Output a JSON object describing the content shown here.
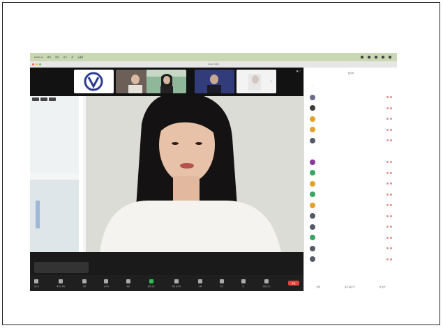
{
  "window": {
    "title": "Zoom 회의"
  },
  "menubar": {
    "items": [
      "zoom.us",
      "회의",
      "편집",
      "보기",
      "창",
      "도움말"
    ],
    "status_icons": [
      "wifi-icon",
      "battery-icon",
      "search-icon",
      "control-center-icon",
      "clock-icon"
    ]
  },
  "participants_strip": [
    {
      "name": "",
      "kind": "logo"
    },
    {
      "name": "",
      "kind": "person"
    },
    {
      "name": "",
      "kind": "person"
    },
    {
      "name": "",
      "kind": "person"
    },
    {
      "name": "",
      "kind": "person"
    }
  ],
  "speaker": {
    "name": ""
  },
  "caption": {
    "text": ""
  },
  "controls": [
    {
      "label": "음소거",
      "icon": "mic-icon"
    },
    {
      "label": "비디오 중지",
      "icon": "camera-icon"
    },
    {
      "label": "보안",
      "icon": "shield-icon"
    },
    {
      "label": "참가자",
      "icon": "people-icon"
    },
    {
      "label": "채팅",
      "icon": "chat-icon"
    },
    {
      "label": "화면 공유",
      "icon": "share-screen-icon"
    },
    {
      "label": "여러 참가자",
      "icon": "multi-share-icon"
    },
    {
      "label": "기록",
      "icon": "record-icon"
    },
    {
      "label": "반응",
      "icon": "reaction-icon"
    },
    {
      "label": "앱",
      "icon": "apps-icon"
    },
    {
      "label": "화이트보드",
      "icon": "whiteboard-icon"
    }
  ],
  "end_button": {
    "label": "종료"
  },
  "panel": {
    "title": "참가자",
    "section_waiting": "",
    "participants": [
      {
        "name": "",
        "color": "#6b6b8a"
      },
      {
        "name": "",
        "color": "#3c3c3c"
      },
      {
        "name": "",
        "color": "#e2a12a"
      },
      {
        "name": "",
        "color": "#e2a12a"
      },
      {
        "name": "",
        "color": "#555b66"
      },
      {
        "name": "",
        "color": "#8b3a9a"
      },
      {
        "name": "",
        "color": "#3aa565"
      },
      {
        "name": "",
        "color": "#e2a12a"
      },
      {
        "name": "",
        "color": "#3aa565"
      },
      {
        "name": "",
        "color": "#e2a12a"
      },
      {
        "name": "",
        "color": "#555b66"
      },
      {
        "name": "",
        "color": "#555b66"
      },
      {
        "name": "",
        "color": "#3aa565"
      },
      {
        "name": "",
        "color": "#555b66"
      },
      {
        "name": "",
        "color": "#555b66"
      }
    ],
    "footer": [
      "초대",
      "모두 음소거",
      "더 보기"
    ]
  }
}
